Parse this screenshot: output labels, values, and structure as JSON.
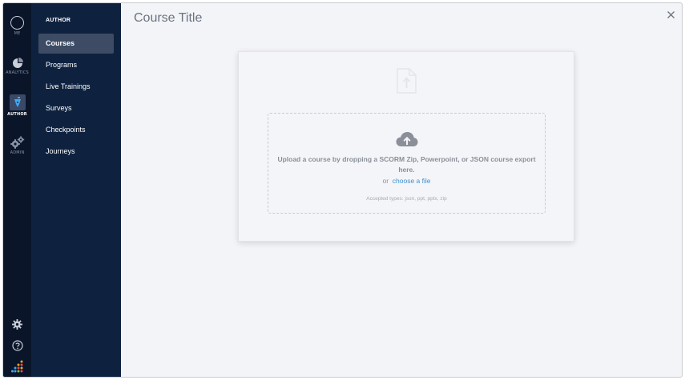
{
  "rail": {
    "me": "ME",
    "analytics": "ANALYTICS",
    "author": "AUTHOR",
    "admin": "ADMIN"
  },
  "sidebar": {
    "heading": "AUTHOR",
    "items": [
      {
        "label": "Courses",
        "active": true
      },
      {
        "label": "Programs",
        "active": false
      },
      {
        "label": "Live Trainings",
        "active": false
      },
      {
        "label": "Surveys",
        "active": false
      },
      {
        "label": "Checkpoints",
        "active": false
      },
      {
        "label": "Journeys",
        "active": false
      }
    ]
  },
  "main": {
    "title": "Course Title",
    "upload": {
      "instruction": "Upload a course by dropping a SCORM Zip, Powerpoint, or JSON course export here.",
      "or_text": "or",
      "choose_link": "choose a file",
      "accepted": "Accepted types: json, ppt, pptx, zip"
    }
  },
  "icons": {
    "close": "close-icon",
    "cloud": "cloud-upload-icon",
    "file": "file-upload-icon",
    "gear": "gear-icon",
    "help": "help-icon",
    "logo": "app-logo-dots"
  },
  "colors": {
    "rail_bg": "#0a1529",
    "sidebar_bg": "#0e2240",
    "active_item": "#3d4c64",
    "link": "#3f8fd0",
    "author_accent": "#3fa9f5"
  }
}
